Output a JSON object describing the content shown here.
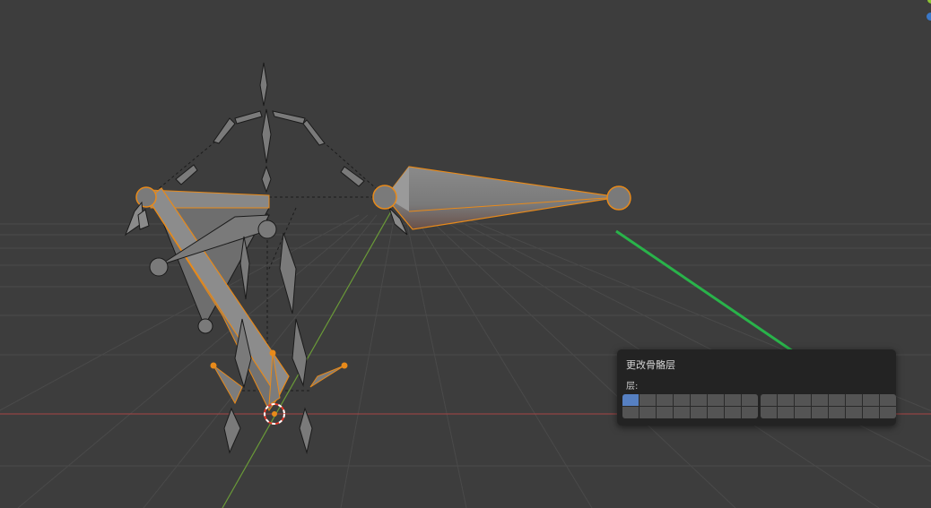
{
  "popup": {
    "title": "更改骨骼层",
    "layers_label": "层:",
    "group_a_active": [
      0
    ],
    "group_b_active": []
  },
  "colors": {
    "background": "#3d3d3d",
    "grid_line": "#4a4a4a",
    "x_axis": "#a84545",
    "y_axis": "#6a9a38",
    "selection": "#e88a1a",
    "annotation_arrow": "#29b34a",
    "active_layer": "#5680c2"
  },
  "icons": [
    "gizmo-z-icon",
    "gizmo-y-icon",
    "green-arrow-icon"
  ]
}
